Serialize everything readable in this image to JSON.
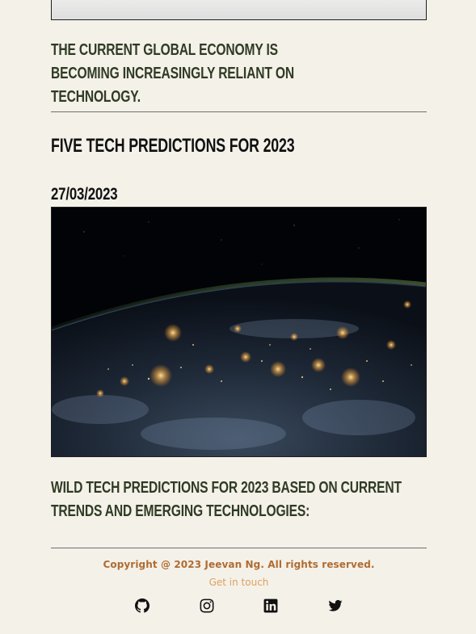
{
  "posts": {
    "previous": {
      "excerpt": "The current global economy is becoming increasingly reliant on technology."
    },
    "current": {
      "title": "Five Tech Predictions for 2023",
      "date": "27/03/2023",
      "excerpt": "Wild tech predictions for 2023 based on current trends and emerging technologies:"
    }
  },
  "footer": {
    "copyright": "Copyright @ 2023 Jeevan Ng. All rights reserved.",
    "contact_link": "Get in touch",
    "socials": [
      "github-icon",
      "instagram-icon",
      "linkedin-icon",
      "twitter-icon"
    ]
  },
  "colors": {
    "background": "#f4f1e9",
    "heading_green": "#2f3b24",
    "copyright": "#b06c31",
    "link": "#e0a15e"
  }
}
